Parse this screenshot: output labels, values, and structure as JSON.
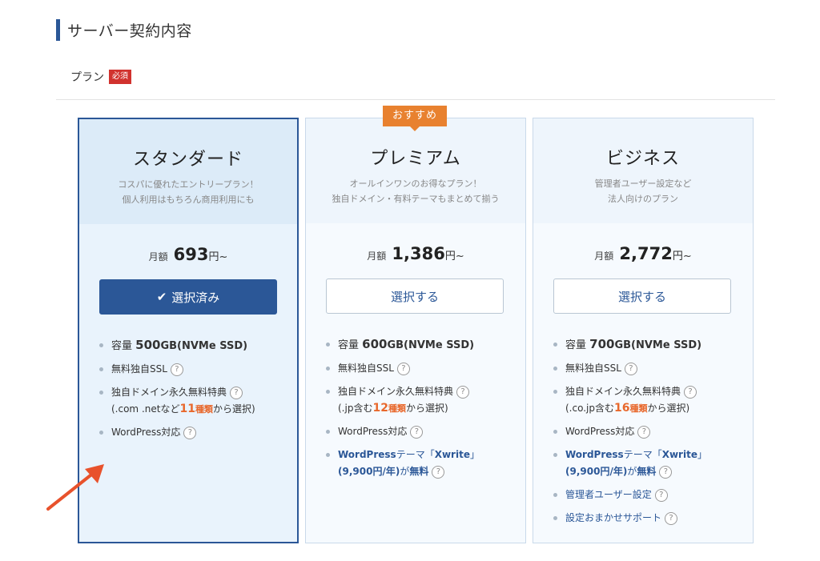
{
  "section": {
    "title": "サーバー契約内容"
  },
  "plan_field": {
    "label": "プラン",
    "required": "必須"
  },
  "recommend": "おすすめ",
  "colors": {
    "accent": "#2b5797",
    "orange": "#e8682c",
    "required": "#d1322e"
  },
  "cards": [
    {
      "name": "スタンダード",
      "desc1": "コスパに優れたエントリープラン！",
      "desc2": "個人利用はもちろん商用利用にも",
      "price_label": "月額",
      "price": "693",
      "price_unit": "円~",
      "button": "選択済み",
      "selected": true,
      "features": {
        "storage_prefix": "容量 ",
        "storage_num": "500",
        "storage_rest": "GB(NVMe SSD)",
        "ssl": "無料独自SSL",
        "domain": "独自ドメイン永久無料特典",
        "domain_pre": "(.com .netなど",
        "domain_num": "11",
        "domain_kind": "種類",
        "domain_post": "から選択)",
        "wordpress": "WordPress対応"
      }
    },
    {
      "name": "プレミアム",
      "desc1": "オールインワンのお得なプラン！",
      "desc2": "独自ドメイン・有料テーマもまとめて揃う",
      "price_label": "月額",
      "price": "1,386",
      "price_unit": "円~",
      "button": "選択する",
      "selected": false,
      "features": {
        "storage_prefix": "容量 ",
        "storage_num": "600",
        "storage_rest": "GB(NVMe SSD)",
        "ssl": "無料独自SSL",
        "domain": "独自ドメイン永久無料特典",
        "domain_pre": "(.jp含む",
        "domain_num": "12",
        "domain_kind": "種類",
        "domain_post": "から選択)",
        "wordpress": "WordPress対応",
        "theme_a": "WordPress",
        "theme_b": "テーマ「",
        "theme_c": "Xwrite",
        "theme_d": "」",
        "theme_price": "(9,900",
        "theme_price_b": "円/年)",
        "theme_free_a": "が",
        "theme_free_b": "無料"
      }
    },
    {
      "name": "ビジネス",
      "desc1": "管理者ユーザー設定など",
      "desc2": "法人向けのプラン",
      "price_label": "月額",
      "price": "2,772",
      "price_unit": "円~",
      "button": "選択する",
      "selected": false,
      "features": {
        "storage_prefix": "容量 ",
        "storage_num": "700",
        "storage_rest": "GB(NVMe SSD)",
        "ssl": "無料独自SSL",
        "domain": "独自ドメイン永久無料特典",
        "domain_pre": "(.co.jp含む",
        "domain_num": "16",
        "domain_kind": "種類",
        "domain_post": "から選択)",
        "wordpress": "WordPress対応",
        "theme_a": "WordPress",
        "theme_b": "テーマ「",
        "theme_c": "Xwrite",
        "theme_d": "」",
        "theme_price": "(9,900",
        "theme_price_b": "円/年)",
        "theme_free_a": "が",
        "theme_free_b": "無料",
        "admin": "管理者ユーザー設定",
        "support": "設定おまかせサポート"
      }
    }
  ]
}
